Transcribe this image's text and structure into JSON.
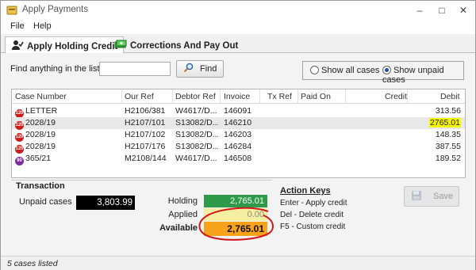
{
  "window": {
    "title": "Apply Payments"
  },
  "menu": {
    "items": [
      "File",
      "Help"
    ]
  },
  "tabs": [
    {
      "label": "Apply Holding Credit",
      "icon": "user-check-icon",
      "active": true
    },
    {
      "label": "Corrections And Pay Out",
      "icon": "money-icon",
      "active": false
    }
  ],
  "find": {
    "label": "Find anything in the list",
    "value": "",
    "button_label": "Find",
    "button_icon": "magnifier-icon"
  },
  "filter": {
    "options": [
      "Show all cases",
      "Show unpaid cases"
    ],
    "selected": "Show unpaid cases"
  },
  "grid": {
    "columns": [
      "Case Number",
      "Our Ref",
      "Debtor Ref",
      "Invoice",
      "Tx Ref",
      "Paid On",
      "Credit",
      "Debit"
    ],
    "rows": [
      {
        "badge": "120",
        "badge_color": "#cc1e1e",
        "case": "LETTER",
        "our_ref": "H2106/381",
        "debtor_ref": "W4617/D...",
        "invoice": "146091",
        "tx_ref": "",
        "paid_on": "",
        "credit": "",
        "debit": "313.56",
        "selected": false,
        "highlight": false
      },
      {
        "badge": "120",
        "badge_color": "#cc1e1e",
        "case": "2028/19",
        "our_ref": "H2107/101",
        "debtor_ref": "S13082/D...",
        "invoice": "146210",
        "tx_ref": "",
        "paid_on": "",
        "credit": "",
        "debit": "2765.01",
        "selected": true,
        "highlight": true
      },
      {
        "badge": "120",
        "badge_color": "#cc1e1e",
        "case": "2028/19",
        "our_ref": "H2107/102",
        "debtor_ref": "S13082/D...",
        "invoice": "146203",
        "tx_ref": "",
        "paid_on": "",
        "credit": "",
        "debit": "148.35",
        "selected": false,
        "highlight": false
      },
      {
        "badge": "120",
        "badge_color": "#cc1e1e",
        "case": "2028/19",
        "our_ref": "H2107/176",
        "debtor_ref": "S13082/D...",
        "invoice": "146284",
        "tx_ref": "",
        "paid_on": "",
        "credit": "",
        "debit": "387.55",
        "selected": false,
        "highlight": false
      },
      {
        "badge": "90",
        "badge_color": "#7b2ca0",
        "case": "365/21",
        "our_ref": "M2108/144",
        "debtor_ref": "W4617/D...",
        "invoice": "146508",
        "tx_ref": "",
        "paid_on": "",
        "credit": "",
        "debit": "189.52",
        "selected": false,
        "highlight": false
      }
    ]
  },
  "transaction": {
    "title": "Transaction",
    "unpaid_label": "Unpaid cases",
    "unpaid_value": "3,803.99",
    "holding_label": "Holding",
    "holding_value": "2,765.01",
    "holding_color": "#2e9a4a",
    "applied_label": "Applied",
    "applied_value": "0.00",
    "applied_color": "#f5eea0",
    "available_label": "Available",
    "available_value": "2,765.01",
    "available_color": "#f7a21b",
    "annotation_color": "#d4141b"
  },
  "action_keys": {
    "title": "Action Keys",
    "lines": [
      "Enter - Apply credit",
      "Del - Delete credit",
      "F5 - Custom credit"
    ]
  },
  "save_button": {
    "label": "Save",
    "icon": "floppy-disk-icon",
    "enabled": false
  },
  "status": {
    "text": "5 cases listed"
  }
}
